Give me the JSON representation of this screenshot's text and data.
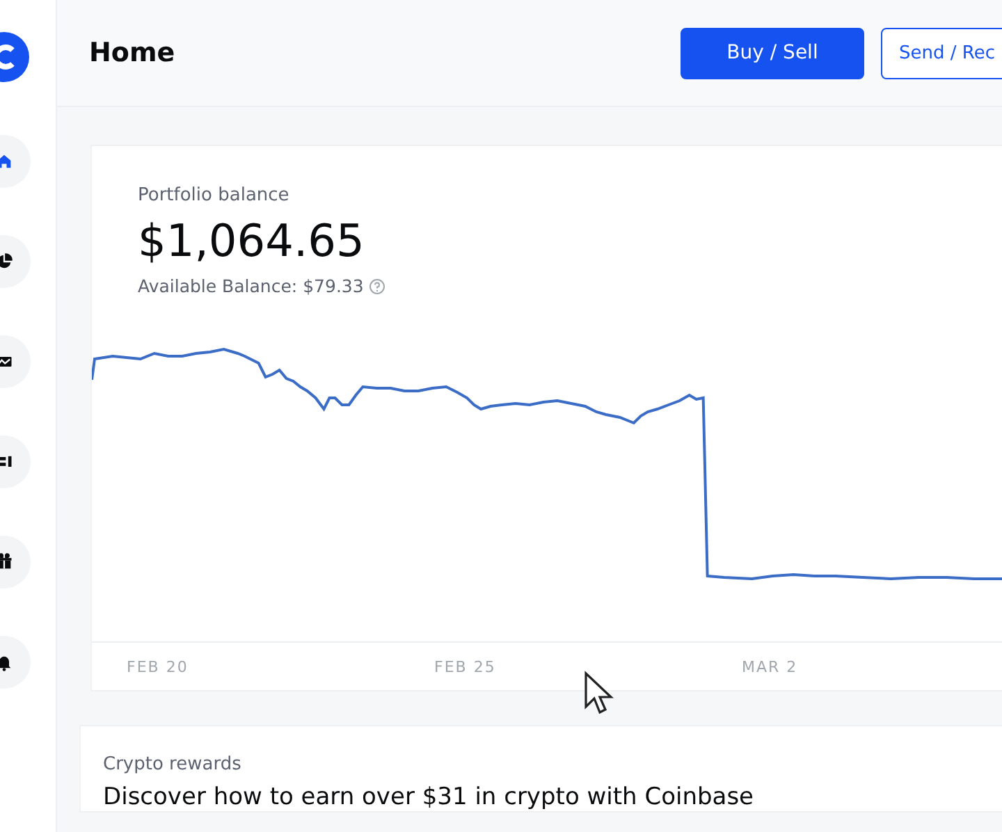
{
  "sidebar": {
    "items": [
      {
        "kind": "home",
        "selected": true
      },
      {
        "kind": "pie",
        "selected": false
      },
      {
        "kind": "trend",
        "selected": false
      },
      {
        "kind": "list",
        "selected": false
      },
      {
        "kind": "gift",
        "selected": false
      },
      {
        "kind": "bell",
        "selected": false
      }
    ]
  },
  "header": {
    "title": "Home",
    "buttons": [
      {
        "label": "Buy / Sell",
        "kind": "primary"
      },
      {
        "label": "Send / Rec",
        "kind": "secondary"
      }
    ]
  },
  "portfolio": {
    "label": "Portfolio balance",
    "balance": "$1,064.65",
    "available": "Available Balance: $79.33",
    "x_labels": [
      "FEB 20",
      "FEB 25",
      "MAR 2"
    ]
  },
  "rewards": {
    "label": "Crypto rewards",
    "headline": "Discover how to earn over $31 in crypto with Coinbase"
  }
}
